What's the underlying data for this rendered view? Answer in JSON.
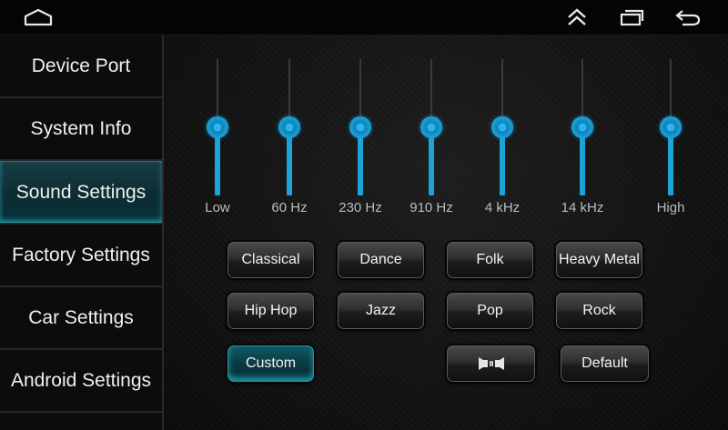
{
  "nav": {
    "home_icon": "home-outline-icon",
    "recent_up_icon": "double-chevron-up-icon",
    "recents_icon": "recent-apps-icon",
    "back_icon": "back-arrow-icon"
  },
  "sidebar": {
    "items": [
      {
        "label": "Device Port"
      },
      {
        "label": "System Info"
      },
      {
        "label": "Sound Settings",
        "active": true
      },
      {
        "label": "Factory Settings"
      },
      {
        "label": "Car Settings"
      },
      {
        "label": "Android Settings"
      }
    ]
  },
  "equalizer": {
    "bands": [
      {
        "label": "Low",
        "level": 0.5
      },
      {
        "label": "60 Hz",
        "level": 0.5
      },
      {
        "label": "230 Hz",
        "level": 0.5
      },
      {
        "label": "910 Hz",
        "level": 0.5
      },
      {
        "label": "4 kHz",
        "level": 0.5
      },
      {
        "label": "14 kHz",
        "level": 0.5
      },
      {
        "label": "High",
        "level": 0.5
      }
    ]
  },
  "presets": {
    "classical": "Classical",
    "dance": "Dance",
    "folk": "Folk",
    "heavy_metal": "Heavy Metal",
    "hip_hop": "Hip Hop",
    "jazz": "Jazz",
    "pop": "Pop",
    "rock": "Rock",
    "custom": "Custom",
    "balance_icon": "speaker-balance-icon",
    "default": "Default"
  },
  "colors": {
    "accent": "#1ea3d9",
    "active_teal": "#1a9aa7"
  }
}
